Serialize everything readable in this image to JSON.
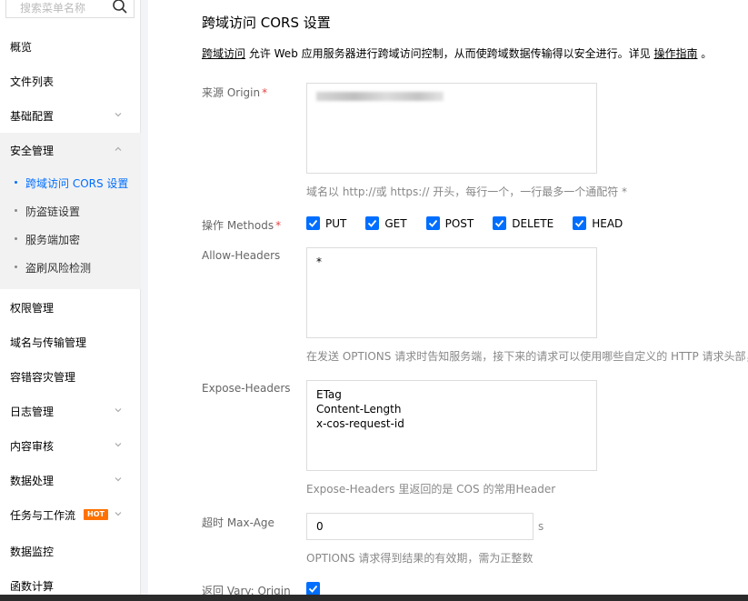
{
  "sidebar": {
    "search_placeholder": "搜索菜单名称",
    "items": [
      {
        "label": "概览"
      },
      {
        "label": "文件列表"
      },
      {
        "label": "基础配置"
      },
      {
        "label": "安全管理"
      },
      {
        "label": "权限管理"
      },
      {
        "label": "域名与传输管理"
      },
      {
        "label": "容错容灾管理"
      },
      {
        "label": "日志管理"
      },
      {
        "label": "内容审核"
      },
      {
        "label": "数据处理"
      },
      {
        "label": "任务与工作流",
        "badge": "HOT"
      },
      {
        "label": "数据监控"
      },
      {
        "label": "函数计算"
      }
    ],
    "security_sub": [
      {
        "label": "跨域访问 CORS 设置",
        "active": true
      },
      {
        "label": "防盗链设置"
      },
      {
        "label": "服务端加密"
      },
      {
        "label": "盗刷风险检测"
      }
    ]
  },
  "main": {
    "title": "跨域访问 CORS 设置",
    "desc": {
      "link1": "跨域访问",
      "text": " 允许 Web 应用服务器进行跨域访问控制，从而使跨域数据传输得以安全进行。详见 ",
      "link2": "操作指南",
      "end": " 。"
    },
    "origin": {
      "label": "来源 Origin",
      "required": "*",
      "hint": "域名以 http://或 https:// 开头，每行一个，一行最多一个通配符 *"
    },
    "methods": {
      "label": "操作 Methods",
      "required": "*",
      "options": [
        {
          "label": "PUT",
          "checked": true
        },
        {
          "label": "GET",
          "checked": true
        },
        {
          "label": "POST",
          "checked": true
        },
        {
          "label": "DELETE",
          "checked": true
        },
        {
          "label": "HEAD",
          "checked": true
        }
      ]
    },
    "allow_headers": {
      "label": "Allow-Headers",
      "value": "*",
      "hint": "在发送 OPTIONS 请求时告知服务端，接下来的请求可以使用哪些自定义的 HTTP 请求头部，"
    },
    "expose_headers": {
      "label": "Expose-Headers",
      "value": "ETag\nContent-Length\nx-cos-request-id",
      "hint": "Expose-Headers 里返回的是 COS 的常用Header"
    },
    "max_age": {
      "label": "超时 Max-Age",
      "value": "0",
      "unit": "s",
      "hint": "OPTIONS 请求得到结果的有效期，需为正整数"
    },
    "vary": {
      "label": "返回 Vary: Origin",
      "checked": true
    }
  }
}
